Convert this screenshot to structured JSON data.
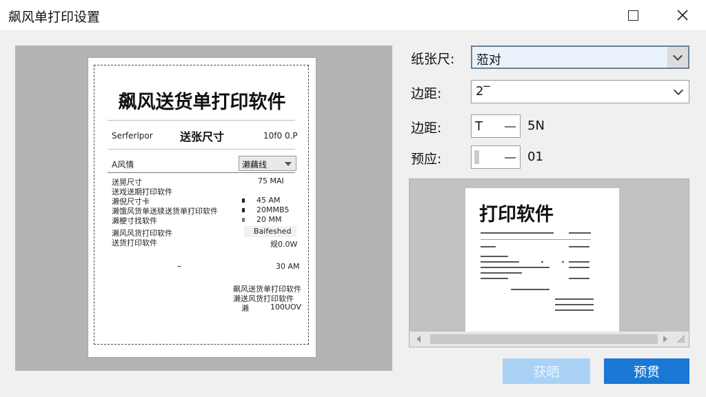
{
  "window": {
    "title": "飙风单打印设置"
  },
  "colors": {
    "accent": "#1a78d4",
    "disabled_button": "#a9d2f5",
    "preview_background": "#b4b4b4"
  },
  "preview": {
    "title": "飙风送货单打印软件",
    "row1_left": "Serferlpor",
    "row1_mid": "送张尺寸",
    "row1_right": "10f0  0.P",
    "select_label": "A风情",
    "select_value": "濑藕线",
    "items": [
      {
        "label": "送晃尺寸",
        "value": "75 MAI"
      },
      {
        "label": "送戏送期打印软件",
        "value": ""
      },
      {
        "label": "濑倪尺寸卡",
        "value": "45 AM"
      },
      {
        "label": "濑饿风货单送牍送货单打印软件",
        "value": "20MMB5"
      },
      {
        "label": "濑梗寸找软件",
        "value": "20 MM"
      }
    ],
    "group_line1": "濑风风货打印软件",
    "group_line2": "送货打印软件",
    "group_value1": "Baifeshed",
    "group_value2": "规0.0W",
    "total_value": "30 AM",
    "footer_line1": "飙风送货单打印软件",
    "footer_line2": "濑送风货打印软件",
    "footer_left": "濑",
    "footer_right": "100UOV"
  },
  "settings": {
    "paper_size": {
      "label": "纸张尺:",
      "value": "蒞对"
    },
    "margin1": {
      "label": "边距:",
      "value": "2‾"
    },
    "margin2": {
      "label": "边距:",
      "spin_value": "T",
      "value": "5N"
    },
    "preset": {
      "label": "预应:",
      "value": "01"
    }
  },
  "thumbnail": {
    "title": "打印软件"
  },
  "buttons": {
    "disabled_label": "获晒",
    "primary_label": "预贯"
  }
}
